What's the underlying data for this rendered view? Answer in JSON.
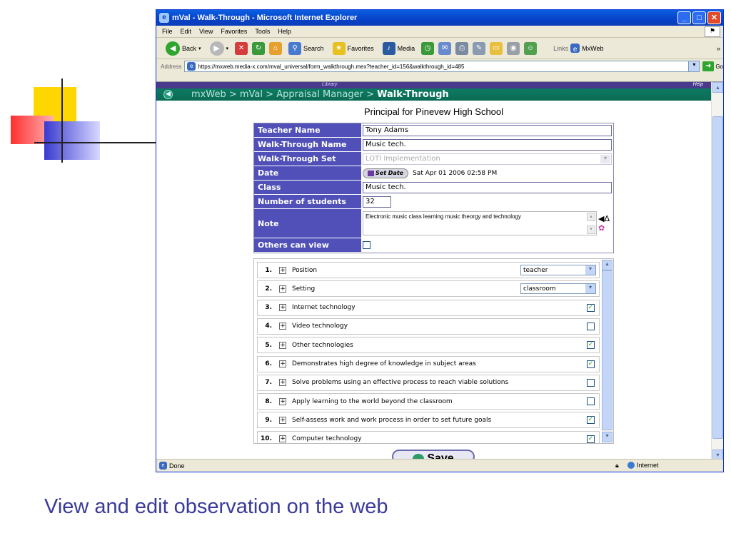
{
  "window": {
    "title": "mVal - Walk-Through - Microsoft Internet Explorer"
  },
  "menu": [
    "File",
    "Edit",
    "View",
    "Favorites",
    "Tools",
    "Help"
  ],
  "toolbar": {
    "back": "Back",
    "search": "Search",
    "favorites": "Favorites",
    "media": "Media",
    "links": "Links",
    "mxweb": "MxWeb"
  },
  "address": {
    "label": "Address",
    "url": "https://mxweb.media-x.com/mval_universal/form_walkthrough.mex?teacher_id=156&walkthrough_id=485",
    "go": "Go"
  },
  "page": {
    "library_label": "Library",
    "help_label": "Help",
    "breadcrumb": {
      "root": "mxWeb",
      "sep": " > ",
      "mval": "mVal",
      "manager": "Appraisal Manager",
      "current": "Walk-Through"
    },
    "title": "Principal for Pinevew High School"
  },
  "form": {
    "teacher_name": {
      "label": "Teacher Name",
      "value": "Tony Adams"
    },
    "walkthrough_name": {
      "label": "Walk-Through Name",
      "value": "Music tech."
    },
    "walkthrough_set": {
      "label": "Walk-Through Set",
      "value": "LOTI Implementation"
    },
    "date": {
      "label": "Date",
      "button": "Set Date",
      "value": "Sat Apr 01 2006 02:58 PM"
    },
    "class": {
      "label": "Class",
      "value": "Music tech."
    },
    "students": {
      "label": "Number of students",
      "value": "32"
    },
    "note": {
      "label": "Note",
      "value": "Electronic music class learning music theorgy and technology"
    },
    "others_can_view": {
      "label": "Others can view",
      "checked": false
    }
  },
  "items": [
    {
      "num": "1.",
      "text": "Position",
      "type": "select",
      "value": "teacher"
    },
    {
      "num": "2.",
      "text": "Setting",
      "type": "select",
      "value": "classroom"
    },
    {
      "num": "3.",
      "text": "Internet technology",
      "type": "check",
      "checked": true
    },
    {
      "num": "4.",
      "text": "Video technology",
      "type": "check",
      "checked": false
    },
    {
      "num": "5.",
      "text": "Other technologies",
      "type": "check",
      "checked": true
    },
    {
      "num": "6.",
      "text": "Demonstrates high degree of knowledge in subject areas",
      "type": "check",
      "checked": true
    },
    {
      "num": "7.",
      "text": "Solve problems using an effective process to reach viable solutions",
      "type": "check",
      "checked": false
    },
    {
      "num": "8.",
      "text": "Apply learning to the world beyond the classroom",
      "type": "check",
      "checked": false
    },
    {
      "num": "9.",
      "text": "Self-assess work and work process in order to set future goals",
      "type": "check",
      "checked": true
    },
    {
      "num": "10.",
      "text": "Computer technology",
      "type": "check",
      "checked": true
    }
  ],
  "save_label": "Save",
  "status": {
    "text": "Done",
    "zone": "Internet"
  },
  "caption": "View and edit observation on the web",
  "colors": {
    "breadcrumb_bg": "#0b6b55",
    "label_bg": "#5050b8",
    "caption": "#3a3a9a",
    "titlebar": "#0842c8"
  }
}
